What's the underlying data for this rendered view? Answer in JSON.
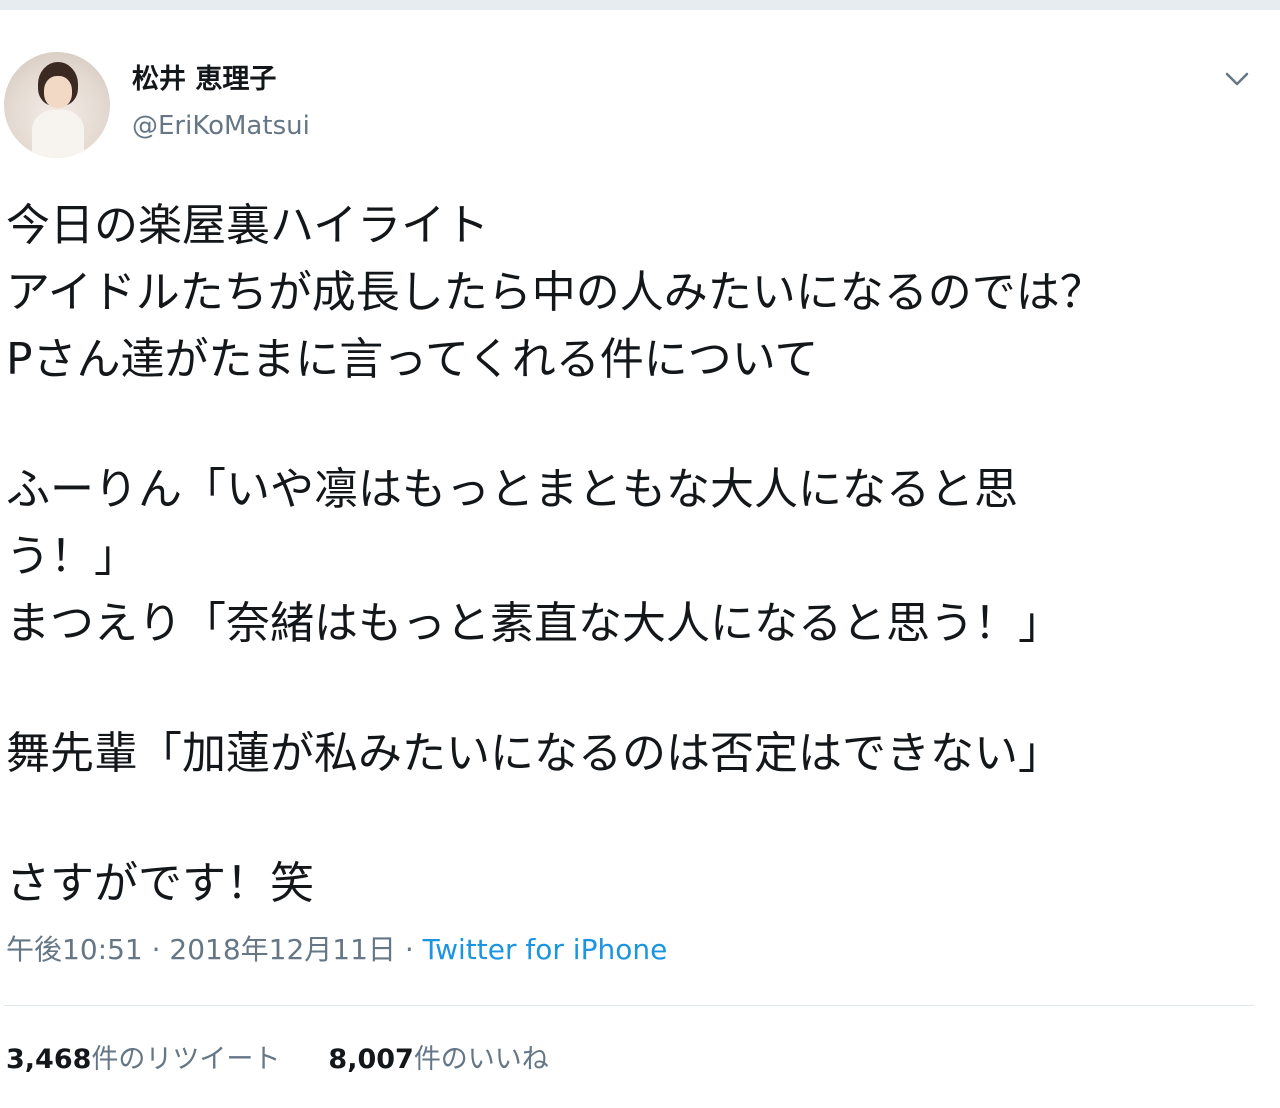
{
  "tweet": {
    "author": {
      "display_name": "松井 恵理子",
      "handle": "@EriKoMatsui"
    },
    "text_lines": [
      "今日の楽屋裏ハイライト",
      "アイドルたちが成長したら中の人みたいになるのでは？",
      "Pさん達がたまに言ってくれる件について",
      "",
      "ふーりん「いや凛はもっとまともな大人になると思",
      "う！」",
      "まつえり「奈緒はもっと素直な大人になると思う！」",
      "",
      "舞先輩「加蓮が私みたいになるのは否定はできない」",
      "",
      "さすがです！笑"
    ],
    "time": "午後10:51",
    "separator": " · ",
    "date": "2018年12月11日",
    "source": "Twitter for iPhone",
    "retweets": {
      "count": "3,468",
      "label": "件のリツイート"
    },
    "likes": {
      "count": "8,007",
      "label": "件のいいね"
    },
    "icons": {
      "menu": "chevron-down-icon",
      "avatar": "profile-photo"
    },
    "colors": {
      "link": "#1b95e0",
      "secondary_text": "#657786",
      "primary_text": "#14171a"
    }
  }
}
